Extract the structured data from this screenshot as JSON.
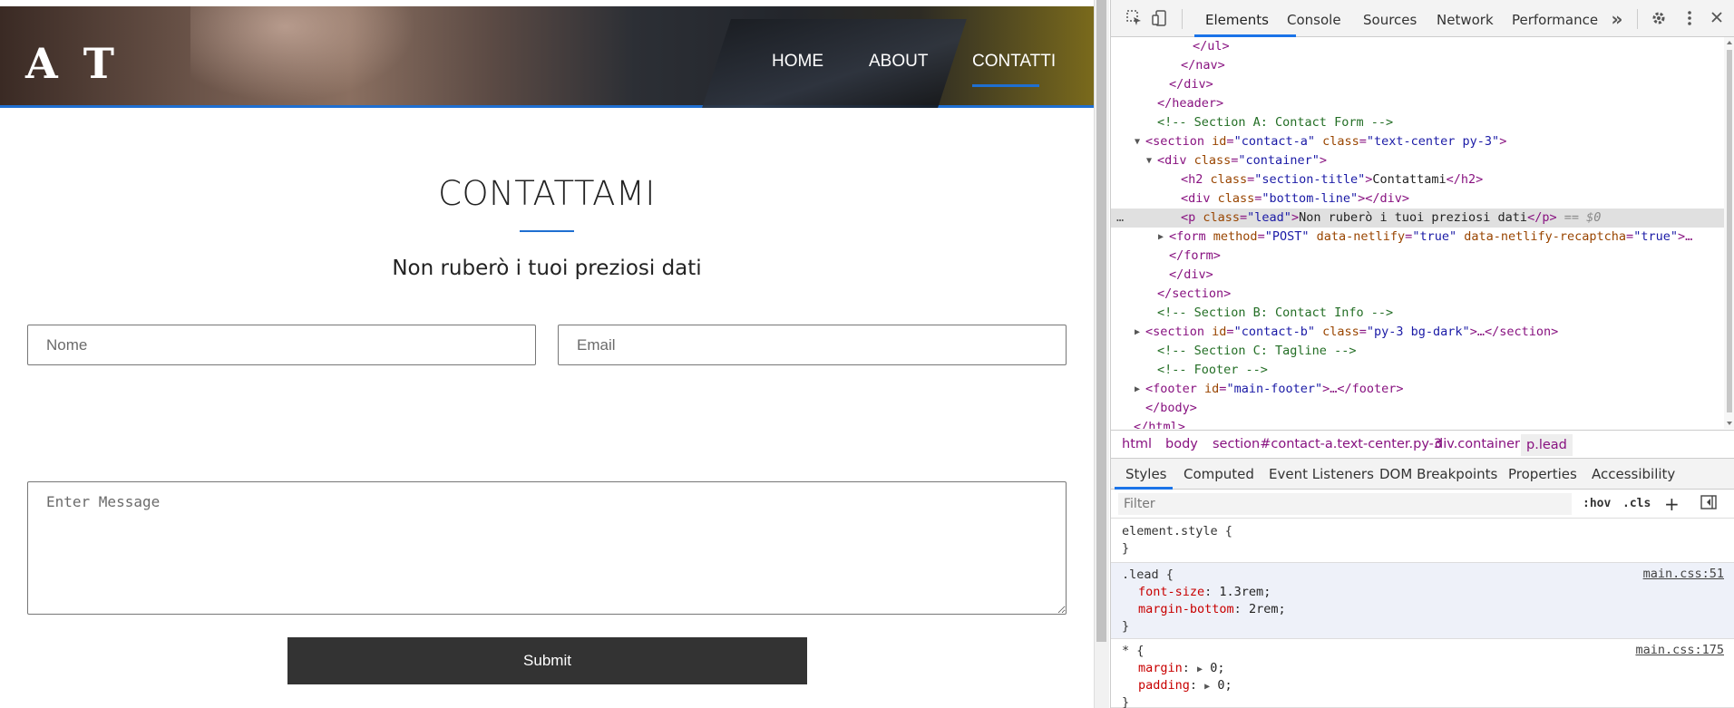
{
  "page": {
    "logo": "A T",
    "nav": {
      "home": "HOME",
      "about": "ABOUT",
      "contatti": "CONTATTI"
    },
    "section_title": "CONTATTAMI",
    "lead": "Non ruberò i tuoi preziosi dati",
    "form": {
      "name_placeholder": "Nome",
      "email_placeholder": "Email",
      "message_placeholder": "Enter Message",
      "submit_label": "Submit"
    },
    "colors": {
      "accent": "#1f6fd1",
      "button": "#333333"
    }
  },
  "devtools": {
    "tabs": [
      "Elements",
      "Console",
      "Sources",
      "Network",
      "Performance"
    ],
    "more_tabs_label": "»",
    "dom_lines": [
      {
        "indent": 6,
        "html": "</ul>",
        "kind": "tag"
      },
      {
        "indent": 5,
        "html": "</nav>",
        "kind": "tag"
      },
      {
        "indent": 4,
        "html": "</div>",
        "kind": "tag"
      },
      {
        "indent": 3,
        "html": "</header>",
        "kind": "tag"
      },
      {
        "indent": 3,
        "html": "<!-- Section A: Contact Form -->",
        "kind": "comment"
      },
      {
        "indent": 2,
        "tri": "▼",
        "parts": [
          [
            "tag",
            "<section "
          ],
          [
            "attr",
            "id"
          ],
          [
            "tag",
            "="
          ],
          [
            "val",
            "\"contact-a\""
          ],
          [
            "tag",
            " "
          ],
          [
            "attr",
            "class"
          ],
          [
            "tag",
            "="
          ],
          [
            "val",
            "\"text-center py-3\""
          ],
          [
            "tag",
            ">"
          ]
        ]
      },
      {
        "indent": 3,
        "tri": "▼",
        "parts": [
          [
            "tag",
            "<div "
          ],
          [
            "attr",
            "class"
          ],
          [
            "tag",
            "="
          ],
          [
            "val",
            "\"container\""
          ],
          [
            "tag",
            ">"
          ]
        ]
      },
      {
        "indent": 5,
        "parts": [
          [
            "tag",
            "<h2 "
          ],
          [
            "attr",
            "class"
          ],
          [
            "tag",
            "="
          ],
          [
            "val",
            "\"section-title\""
          ],
          [
            "tag",
            ">"
          ],
          [
            "txt",
            "Contattami"
          ],
          [
            "tag",
            "</h2>"
          ]
        ]
      },
      {
        "indent": 5,
        "parts": [
          [
            "tag",
            "<div "
          ],
          [
            "attr",
            "class"
          ],
          [
            "tag",
            "="
          ],
          [
            "val",
            "\"bottom-line\""
          ],
          [
            "tag",
            "></div>"
          ]
        ]
      },
      {
        "indent": 5,
        "selected": true,
        "parts": [
          [
            "tag",
            "<p "
          ],
          [
            "attr",
            "class"
          ],
          [
            "tag",
            "="
          ],
          [
            "val",
            "\"lead\""
          ],
          [
            "tag",
            ">"
          ],
          [
            "txt",
            "Non ruberò i tuoi preziosi dati"
          ],
          [
            "tag",
            "</p>"
          ],
          [
            "eq",
            " == $0"
          ]
        ]
      },
      {
        "indent": 4,
        "tri": "▶",
        "parts": [
          [
            "tag",
            "<form "
          ],
          [
            "attr",
            "method"
          ],
          [
            "tag",
            "="
          ],
          [
            "val",
            "\"POST\""
          ],
          [
            "tag",
            " "
          ],
          [
            "attr",
            "data-netlify"
          ],
          [
            "tag",
            "="
          ],
          [
            "val",
            "\"true\""
          ],
          [
            "tag",
            " "
          ],
          [
            "attr",
            "data-netlify-recaptcha"
          ],
          [
            "tag",
            "="
          ],
          [
            "val",
            "\"true\""
          ],
          [
            "tag",
            ">…"
          ]
        ]
      },
      {
        "indent": 4,
        "html": "</form>",
        "kind": "tag"
      },
      {
        "indent": 4,
        "html": "</div>",
        "kind": "tag"
      },
      {
        "indent": 3,
        "html": "</section>",
        "kind": "tag"
      },
      {
        "indent": 3,
        "html": "<!-- Section B: Contact Info -->",
        "kind": "comment"
      },
      {
        "indent": 2,
        "tri": "▶",
        "parts": [
          [
            "tag",
            "<section "
          ],
          [
            "attr",
            "id"
          ],
          [
            "tag",
            "="
          ],
          [
            "val",
            "\"contact-b\""
          ],
          [
            "tag",
            " "
          ],
          [
            "attr",
            "class"
          ],
          [
            "tag",
            "="
          ],
          [
            "val",
            "\"py-3 bg-dark\""
          ],
          [
            "tag",
            ">…</section>"
          ]
        ]
      },
      {
        "indent": 3,
        "html": "<!-- Section C: Tagline -->",
        "kind": "comment"
      },
      {
        "indent": 3,
        "html": "<!-- Footer -->",
        "kind": "comment"
      },
      {
        "indent": 2,
        "tri": "▶",
        "parts": [
          [
            "tag",
            "<footer "
          ],
          [
            "attr",
            "id"
          ],
          [
            "tag",
            "="
          ],
          [
            "val",
            "\"main-footer\""
          ],
          [
            "tag",
            ">…</footer>"
          ]
        ]
      },
      {
        "indent": 2,
        "html": "</body>",
        "kind": "tag"
      },
      {
        "indent": 1,
        "html": "</html>",
        "kind": "tag"
      }
    ],
    "breadcrumbs": {
      "html": "html",
      "body": "body",
      "section": "section#contact-a.text-center.py-3",
      "container": "div.container",
      "lead": "p.lead"
    },
    "style_tabs": [
      "Styles",
      "Computed",
      "Event Listeners",
      "DOM Breakpoints",
      "Properties",
      "Accessibility"
    ],
    "filter_placeholder": "Filter",
    "hov": ":hov",
    "cls": ".cls",
    "rules": {
      "element_style": {
        "selector": "element.style {",
        "close": "}"
      },
      "lead": {
        "selector": ".lead {",
        "source": "main.css:51",
        "props": [
          {
            "name": "font-size",
            "value": "1.3rem;"
          },
          {
            "name": "margin-bottom",
            "value": "2rem;"
          }
        ],
        "close": "}"
      },
      "universal": {
        "selector": "* {",
        "source": "main.css:175",
        "props": [
          {
            "name": "margin",
            "value": "0;"
          },
          {
            "name": "padding",
            "value": "0;"
          }
        ],
        "close": "}"
      }
    }
  }
}
